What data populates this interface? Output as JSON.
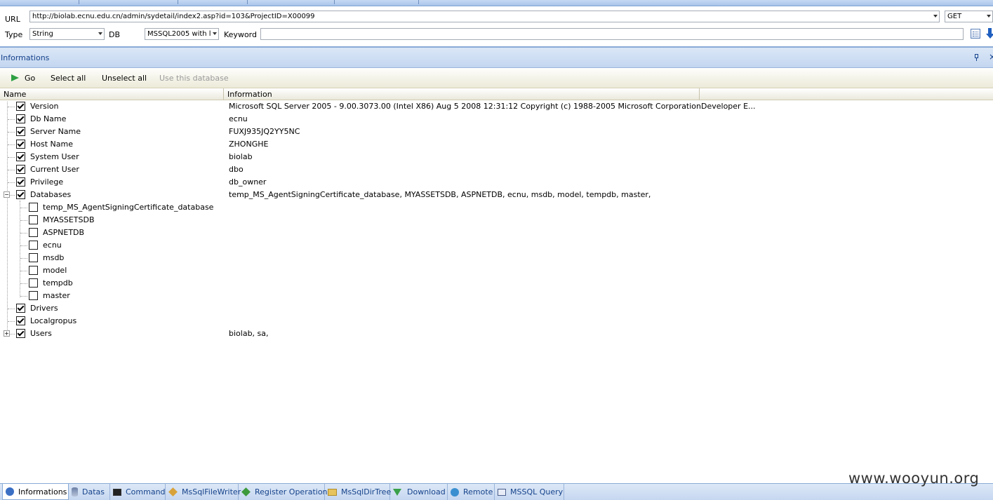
{
  "url_bar": {
    "url_label": "URL",
    "url_value": "http://biolab.ecnu.edu.cn/admin/sydetail/index2.asp?id=103&ProjectID=X00099",
    "method": "GET",
    "type_label": "Type",
    "type_value": "String",
    "db_label": "DB",
    "db_value": "MSSQL2005 with l",
    "keyword_label": "Keyword",
    "keyword_value": ""
  },
  "panel": {
    "title": "Informations"
  },
  "toolbar": {
    "go": "Go",
    "select_all": "Select all",
    "unselect_all": "Unselect all",
    "use_db": "Use this database"
  },
  "columns": {
    "name": "Name",
    "information": "Information"
  },
  "rows": [
    {
      "name": "Version",
      "checked": true,
      "info": "Microsoft SQL Server 2005 - 9.00.3073.00 (Intel X86) Aug  5 2008 12:31:12 Copyright (c) 1988-2005 Microsoft CorporationDeveloper E..."
    },
    {
      "name": "Db Name",
      "checked": true,
      "info": "ecnu"
    },
    {
      "name": "Server Name",
      "checked": true,
      "info": "FUXJ935JQ2YY5NC"
    },
    {
      "name": "Host Name",
      "checked": true,
      "info": "ZHONGHE"
    },
    {
      "name": "System User",
      "checked": true,
      "info": "biolab"
    },
    {
      "name": "Current User",
      "checked": true,
      "info": "dbo"
    },
    {
      "name": "Privilege",
      "checked": true,
      "info": "db_owner"
    },
    {
      "name": "Databases",
      "checked": true,
      "info": "temp_MS_AgentSigningCertificate_database, MYASSETSDB, ASPNETDB, ecnu, msdb, model, tempdb, master,"
    },
    {
      "name": "temp_MS_AgentSigningCertificate_database",
      "checked": false,
      "info": ""
    },
    {
      "name": "MYASSETSDB",
      "checked": false,
      "info": ""
    },
    {
      "name": "ASPNETDB",
      "checked": false,
      "info": ""
    },
    {
      "name": "ecnu",
      "checked": false,
      "info": ""
    },
    {
      "name": "msdb",
      "checked": false,
      "info": ""
    },
    {
      "name": "model",
      "checked": false,
      "info": ""
    },
    {
      "name": "tempdb",
      "checked": false,
      "info": ""
    },
    {
      "name": "master",
      "checked": false,
      "info": ""
    },
    {
      "name": "Drivers",
      "checked": true,
      "info": ""
    },
    {
      "name": "Localgropus",
      "checked": true,
      "info": ""
    },
    {
      "name": "Users",
      "checked": true,
      "info": "biolab, sa,"
    }
  ],
  "expander_symbols": {
    "collapse": "−",
    "expand": "+"
  },
  "bottom_tabs": [
    {
      "label": "Informations",
      "icon": "info-icon"
    },
    {
      "label": "Datas",
      "icon": "database-icon"
    },
    {
      "label": "Command",
      "icon": "terminal-icon"
    },
    {
      "label": "MsSqlFileWriter",
      "icon": "pencil-icon"
    },
    {
      "label": "Register Operation",
      "icon": "registry-icon"
    },
    {
      "label": "MsSqlDirTree",
      "icon": "folder-icon"
    },
    {
      "label": "Download",
      "icon": "download-icon"
    },
    {
      "label": "Remote",
      "icon": "globe-icon"
    },
    {
      "label": "MSSQL Query",
      "icon": "sql-icon"
    }
  ],
  "watermark": "www.wooyun.org"
}
